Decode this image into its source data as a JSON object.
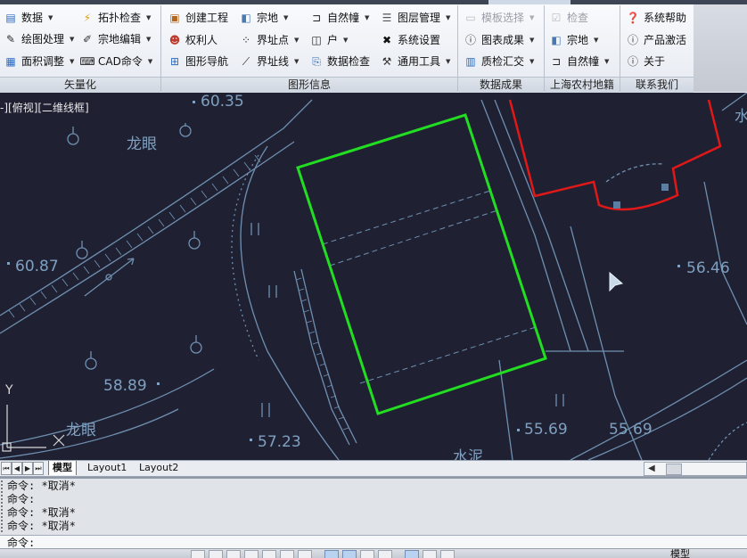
{
  "ribbon": {
    "groups": {
      "vectorize": "矢量化",
      "graphic_info": "图形信息",
      "data_results": "数据成果",
      "shanghai_cadastre": "上海农村地籍",
      "contact": "联系我们"
    },
    "vectorize": {
      "data": "数据",
      "topology_check": "拓扑检查",
      "drawing_process": "绘图处理",
      "parcel_edit": "宗地编辑",
      "area_adjust": "面积调整",
      "cad_command": "CAD命令"
    },
    "graphic_info": {
      "create_project": "创建工程",
      "right_holder": "权利人",
      "graphic_nav": "图形导航",
      "parcel": "宗地",
      "boundary_point": "界址点",
      "boundary_line": "界址线",
      "natural_building": "自然幢",
      "household": "户",
      "data_check": "数据检查",
      "layer_manage": "图层管理",
      "system_settings": "系统设置",
      "general_tools": "通用工具"
    },
    "data_results": {
      "template_select": "模板选择",
      "chart_results": "图表成果",
      "qc_summary": "质检汇交"
    },
    "shanghai": {
      "check": "检查",
      "parcel": "宗地",
      "natural_building": "自然幢"
    },
    "contact": {
      "system_help": "系统帮助",
      "product_activation": "产品激活",
      "about": "关于"
    }
  },
  "drawing": {
    "view_label": "-][俯视][二维线框]",
    "texts": {
      "elev_6035": "60.35",
      "longyan_top": "龙眼",
      "elev_6087": "60.87",
      "elev_5889": "58.89",
      "longyan_bottom": "龙眼",
      "elev_5723": "57.23",
      "shuini": "水泥",
      "elev_5569a": "55.69",
      "elev_5569b": "55.69",
      "elev_5646": "56.46",
      "edge_shui": "水"
    },
    "ucs_y": "Y"
  },
  "layout_tabs": [
    "模型",
    "Layout1",
    "Layout2"
  ],
  "command": {
    "lines": [
      "命令: *取消*",
      "命令:",
      "命令: *取消*",
      "命令: *取消*"
    ],
    "prompt": "命令:"
  },
  "status": {
    "model_label": "模型"
  },
  "colors": {
    "canvas_bg": "#1f2133",
    "lines": "#6f8fb0",
    "selected_parcel": "#22dd22",
    "red_building": "#e01818"
  }
}
